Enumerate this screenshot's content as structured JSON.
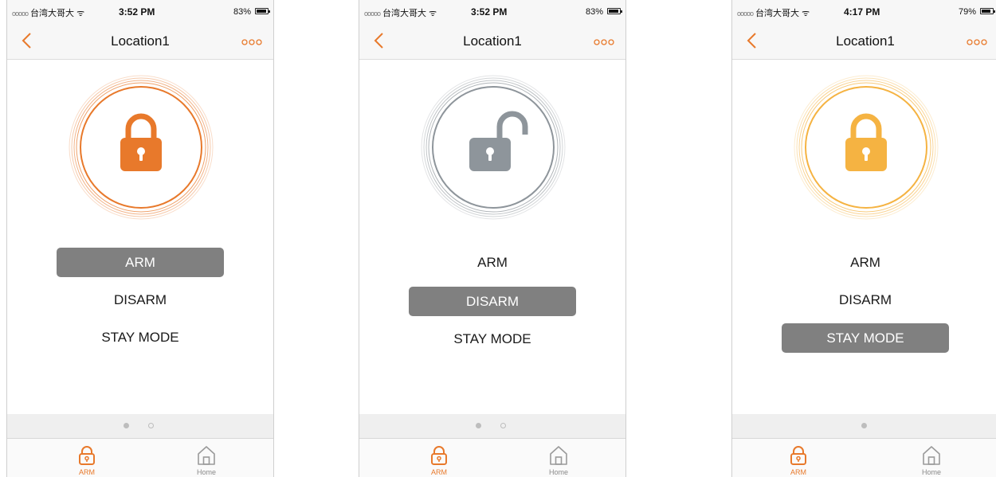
{
  "colors": {
    "accent": "#E8792B",
    "selected_bg": "#808080",
    "inactive_icon": "#9a9a9a",
    "nav_bg": "#F7F7F7"
  },
  "screens": [
    {
      "status": {
        "signal": "ooooo",
        "carrier": "台湾大哥大",
        "time": "3:52 PM",
        "battery": "83%",
        "battery_level": 0.83
      },
      "nav": {
        "back_icon": "chevron-left-icon",
        "title": "Location1",
        "more_icon": "more-dots-icon"
      },
      "lock": {
        "state": "locked",
        "color": "#E8792B"
      },
      "menu": [
        {
          "label": "ARM",
          "selected": true
        },
        {
          "label": "DISARM",
          "selected": false
        },
        {
          "label": "STAY MODE",
          "selected": false
        }
      ],
      "pager": {
        "pages": 2,
        "current": 0
      },
      "tabs": [
        {
          "label": "ARM",
          "icon": "lock-icon",
          "active": true
        },
        {
          "label": "Home",
          "icon": "home-icon",
          "active": false
        }
      ]
    },
    {
      "status": {
        "signal": "ooooo",
        "carrier": "台湾大哥大",
        "time": "3:52 PM",
        "battery": "83%",
        "battery_level": 0.83
      },
      "nav": {
        "back_icon": "chevron-left-icon",
        "title": "Location1",
        "more_icon": "more-dots-icon"
      },
      "lock": {
        "state": "unlocked",
        "color": "#8E959B"
      },
      "menu": [
        {
          "label": "ARM",
          "selected": false
        },
        {
          "label": "DISARM",
          "selected": true
        },
        {
          "label": "STAY MODE",
          "selected": false
        }
      ],
      "pager": {
        "pages": 2,
        "current": 0
      },
      "tabs": [
        {
          "label": "ARM",
          "icon": "lock-icon",
          "active": true
        },
        {
          "label": "Home",
          "icon": "home-icon",
          "active": false
        }
      ]
    },
    {
      "status": {
        "signal": "ooooo",
        "carrier": "台湾大哥大",
        "time": "4:17 PM",
        "battery": "79%",
        "battery_level": 0.79
      },
      "nav": {
        "back_icon": "chevron-left-icon",
        "title": "Location1",
        "more_icon": "more-dots-icon"
      },
      "lock": {
        "state": "locked",
        "color": "#F5B342"
      },
      "menu": [
        {
          "label": "ARM",
          "selected": false
        },
        {
          "label": "DISARM",
          "selected": false
        },
        {
          "label": "STAY MODE",
          "selected": true
        }
      ],
      "pager": {
        "pages": 1,
        "current": 0
      },
      "tabs": [
        {
          "label": "ARM",
          "icon": "lock-icon",
          "active": true
        },
        {
          "label": "Home",
          "icon": "home-icon",
          "active": false
        }
      ]
    }
  ]
}
